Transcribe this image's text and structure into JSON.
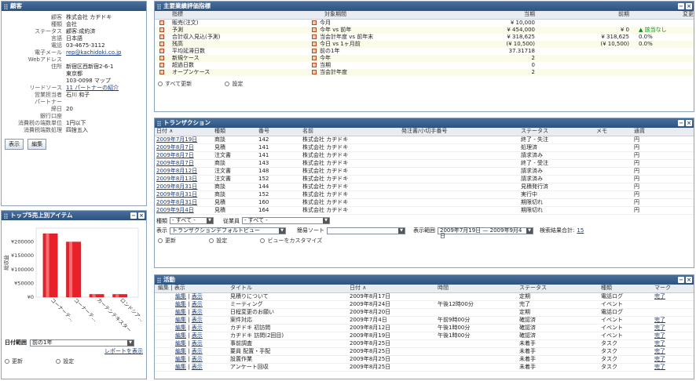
{
  "customer": {
    "title": "顧客",
    "fields": [
      {
        "label": "顧客",
        "value": "株式会社 カヂドキ"
      },
      {
        "label": "種類",
        "value": "会社"
      },
      {
        "label": "ステータス",
        "value": "顧客:成約済"
      },
      {
        "label": "言語",
        "value": "日本語"
      },
      {
        "label": "電話",
        "value": "03-4675-3112"
      },
      {
        "label": "電子メール",
        "value": "rep@kachidoki.co.jp",
        "link": true
      },
      {
        "label": "Webアドレス",
        "value": ""
      },
      {
        "label": "住所",
        "value": "新宿区西新宿2-6-1"
      },
      {
        "label": "",
        "value": "東京都"
      },
      {
        "label": "",
        "value": "103-0098 マップ"
      },
      {
        "label": "リードソース",
        "value": "11 パートナーの紹介",
        "link": true
      },
      {
        "label": "営業担当者",
        "value": "石川 和子"
      },
      {
        "label": "パートナー",
        "value": ""
      },
      {
        "label": "締日",
        "value": "20"
      },
      {
        "label": "銀行口座",
        "value": ""
      },
      {
        "label": "消費税の端数単位",
        "value": "1円以下"
      },
      {
        "label": "消費税端数処理",
        "value": "四捨五入"
      }
    ],
    "buttons": {
      "show": "表示",
      "edit": "編集"
    }
  },
  "top_items": {
    "title": "トップ5売上別アイテム",
    "date_range_label": "日付範囲",
    "date_range_value": "前の1年",
    "report_link": "レポートを表示",
    "refresh": "更新",
    "settings": "設定",
    "chart_data": {
      "type": "bar",
      "ylabel": "総収益",
      "categories": [
        "コーナーテ...",
        "コーナーテ...",
        "カーテンテキスター",
        "ロンドシア..."
      ],
      "values": [
        230000,
        200000,
        10000,
        10000
      ],
      "ylim": [
        0,
        250000
      ],
      "yticks": [
        "¥0",
        "¥50000",
        "¥100000",
        "¥150000",
        "¥200000"
      ],
      "ytick_values": [
        0,
        50000,
        100000,
        150000,
        200000
      ],
      "bar_color": "#e8202a"
    }
  },
  "kpi": {
    "title": "主要業績評価指標",
    "headers": [
      "指標",
      "対象期間",
      "当期",
      "前期",
      "変更"
    ],
    "rows": [
      {
        "name": "販売(注文)",
        "period": "今月",
        "cur": "¥ 10,000",
        "prev": "",
        "chg": ""
      },
      {
        "name": "予測",
        "period": "今年 vs 前年",
        "cur": "¥ 454,000",
        "prev": "¥ 0",
        "chg": "▲ 該当なし"
      },
      {
        "name": "合計収入見込(予測)",
        "period": "当会計年度 vs 前年末",
        "cur": "¥ 318,625",
        "prev": "¥ 318,625",
        "chg": "0.0%"
      },
      {
        "name": "残高",
        "period": "今日 vs 1ヶ月前",
        "cur": "(¥ 10,500)",
        "prev": "(¥ 10,500)",
        "chg": "0.0%"
      },
      {
        "name": "平均延滞日数",
        "period": "前の1年",
        "cur": "37.31718",
        "prev": "",
        "chg": ""
      },
      {
        "name": "新規ケース",
        "period": "今年",
        "cur": "2",
        "prev": "",
        "chg": ""
      },
      {
        "name": "超過日数",
        "period": "当期",
        "cur": "0",
        "prev": "",
        "chg": ""
      },
      {
        "name": "オープンケース",
        "period": "当会計年度",
        "cur": "2",
        "prev": "",
        "chg": ""
      }
    ],
    "refresh_all": "すべて更新",
    "settings": "設定"
  },
  "transactions": {
    "title": "トランザクション",
    "headers": [
      "日付 ∧",
      "種類",
      "番号",
      "名前",
      "発注書/小切手番号",
      "ステータス",
      "メモ",
      "通貨"
    ],
    "rows": [
      [
        "2009年7月19日",
        "商談",
        "142",
        "株式会社 カヂドキ",
        "",
        "終了 - 失注",
        "",
        "円"
      ],
      [
        "2009年8月7日",
        "見積",
        "141",
        "株式会社 カヂドキ",
        "",
        "処理済",
        "",
        "円"
      ],
      [
        "2009年8月7日",
        "注文書",
        "141",
        "株式会社 カヂドキ",
        "",
        "請求済み",
        "",
        "円"
      ],
      [
        "2009年8月7日",
        "商談",
        "143",
        "株式会社 カヂドキ",
        "",
        "終了 - 受注",
        "",
        "円"
      ],
      [
        "2009年8月12日",
        "注文書",
        "148",
        "株式会社 カヂドキ",
        "",
        "請求済み",
        "",
        "円"
      ],
      [
        "2009年8月13日",
        "注文書",
        "152",
        "株式会社 カヂドキ",
        "",
        "請求済み",
        "",
        "円"
      ],
      [
        "2009年8月31日",
        "商談",
        "144",
        "株式会社 カヂドキ",
        "",
        "見積発行済",
        "",
        "円"
      ],
      [
        "2009年8月31日",
        "商談",
        "152",
        "株式会社 カヂドキ",
        "",
        "実行中",
        "",
        "円"
      ],
      [
        "2009年8月31日",
        "見積",
        "160",
        "株式会社 カヂドキ",
        "",
        "期限切れ",
        "",
        "円"
      ],
      [
        "2009年9月4日",
        "見積",
        "164",
        "株式会社 カヂドキ",
        "",
        "期限切れ",
        "",
        "円"
      ]
    ],
    "filter_type_label": "種類",
    "filter_type_value": "- すべて -",
    "filter_emp_label": "従業員",
    "filter_emp_value": "- すべて -",
    "view_label": "表示",
    "view_value": "トランザクションデフォルトビュー",
    "sort_label": "簡易ソート",
    "sort_value": "",
    "range_label": "表示範囲",
    "range_value": "2009年7月19日 — 2009年9月4日",
    "total_label": "検索結果合計:",
    "total_value": "15",
    "refresh": "更新",
    "settings": "設定",
    "customize": "ビューをカスタマイズ"
  },
  "activities": {
    "title": "活動",
    "headers": [
      "編集 | 表示",
      "タイトル",
      "日付 ∧",
      "時間",
      "ステータス",
      "種類",
      "マーク"
    ],
    "edit": "編集",
    "view": "表示",
    "rows": [
      [
        "見積りについて",
        "2009年8月17日",
        "",
        "定期",
        "電話ログ",
        "完了"
      ],
      [
        "ミーティング",
        "2009年8月24日",
        "午後12時00分",
        "完了",
        "イベント",
        ""
      ],
      [
        "日程変更のお願い",
        "2009年8月20日",
        "",
        "定期",
        "電話ログ",
        ""
      ],
      [
        "案件対応",
        "2009年7月4日",
        "午前9時00分",
        "確認済",
        "イベント",
        "完了"
      ],
      [
        "カヂドキ 初訪問",
        "2009年8月12日",
        "午後1時00分",
        "確認済",
        "イベント",
        "完了"
      ],
      [
        "カヂドキ 訪問(2回目)",
        "2009年8月19日",
        "午後1時00分",
        "確認済",
        "イベント",
        "完了"
      ],
      [
        "事前調査",
        "2009年8月25日",
        "",
        "未着手",
        "タスク",
        "完了"
      ],
      [
        "要員 配置・手配",
        "2009年8月25日",
        "",
        "未着手",
        "タスク",
        "完了"
      ],
      [
        "設置作業",
        "2009年8月25日",
        "",
        "未着手",
        "タスク",
        "完了"
      ],
      [
        "アンケート回収",
        "2009年8月25日",
        "",
        "未着手",
        "タスク",
        "完了"
      ]
    ]
  }
}
